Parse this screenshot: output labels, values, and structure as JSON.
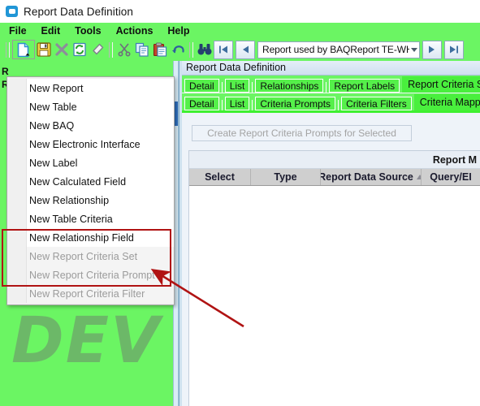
{
  "window": {
    "title": "Report Data Definition",
    "icon": "window-icon"
  },
  "menubar": {
    "items": [
      {
        "label": "File"
      },
      {
        "label": "Edit"
      },
      {
        "label": "Tools"
      },
      {
        "label": "Actions"
      },
      {
        "label": "Help"
      }
    ]
  },
  "toolbar": {
    "buttons": [
      {
        "name": "new-button",
        "icon": "new-document-icon"
      },
      {
        "name": "save-button",
        "icon": "save-disk-icon"
      },
      {
        "name": "delete-button",
        "icon": "delete-x-icon"
      },
      {
        "name": "refresh-button",
        "icon": "refresh-icon"
      },
      {
        "name": "clear-button",
        "icon": "eraser-icon"
      },
      {
        "name": "cut-button",
        "icon": "scissors-icon"
      },
      {
        "name": "copy-button",
        "icon": "copy-icon"
      },
      {
        "name": "paste-button",
        "icon": "paste-clipboard-icon"
      },
      {
        "name": "undo-button",
        "icon": "undo-arrow-icon"
      },
      {
        "name": "find-button",
        "icon": "binoculars-icon"
      }
    ],
    "navigation": {
      "first_label": "first-record",
      "previous_label": "previous-record",
      "next_label": "next-record",
      "last_label": "last-record",
      "combo_value": "Report used by BAQReport TE-WHS"
    }
  },
  "dropdown": {
    "name": "new-menu",
    "items": [
      {
        "label": "New Report",
        "disabled": false
      },
      {
        "label": "New Table",
        "disabled": false
      },
      {
        "label": "New BAQ",
        "disabled": false
      },
      {
        "label": "New Electronic Interface",
        "disabled": false
      },
      {
        "label": "New Label",
        "disabled": false
      },
      {
        "label": "New Calculated Field",
        "disabled": false
      },
      {
        "label": "New Relationship",
        "disabled": false
      },
      {
        "label": "New Table Criteria",
        "disabled": false
      },
      {
        "label": "New Relationship Field",
        "disabled": false
      },
      {
        "label": "New Report Criteria Set",
        "disabled": true
      },
      {
        "label": "New Report Criteria Prompt",
        "disabled": true
      },
      {
        "label": "New Report Criteria Filter",
        "disabled": true
      }
    ]
  },
  "tree": {
    "rows": [
      "R",
      "R"
    ],
    "watermark": "DEV"
  },
  "right_panel": {
    "title": "Report Data Definition",
    "tabs_primary": [
      {
        "label": "Detail",
        "selected": false
      },
      {
        "label": "List",
        "selected": false
      },
      {
        "label": "Relationships",
        "selected": false
      },
      {
        "label": "Report Labels",
        "selected": false
      },
      {
        "label": "Report Criteria Sets",
        "selected": true
      }
    ],
    "tabs_secondary": [
      {
        "label": "Detail",
        "selected": false
      },
      {
        "label": "List",
        "selected": false
      },
      {
        "label": "Criteria Prompts",
        "selected": false
      },
      {
        "label": "Criteria Filters",
        "selected": false
      },
      {
        "label": "Criteria Mappings",
        "selected": true
      }
    ],
    "create_button": "Create Report Criteria Prompts for Selected",
    "grid": {
      "group_header": "Report M",
      "columns": [
        {
          "label": "Select",
          "sorted": false
        },
        {
          "label": "Type",
          "sorted": false
        },
        {
          "label": "Report Data Source",
          "sorted": true
        },
        {
          "label": "Query/EI",
          "sorted": false
        }
      ],
      "rows": []
    }
  },
  "annotation": {
    "highlight_color": "#b01313",
    "arrow_color": "#b01313",
    "name": "red-highlight-box"
  }
}
